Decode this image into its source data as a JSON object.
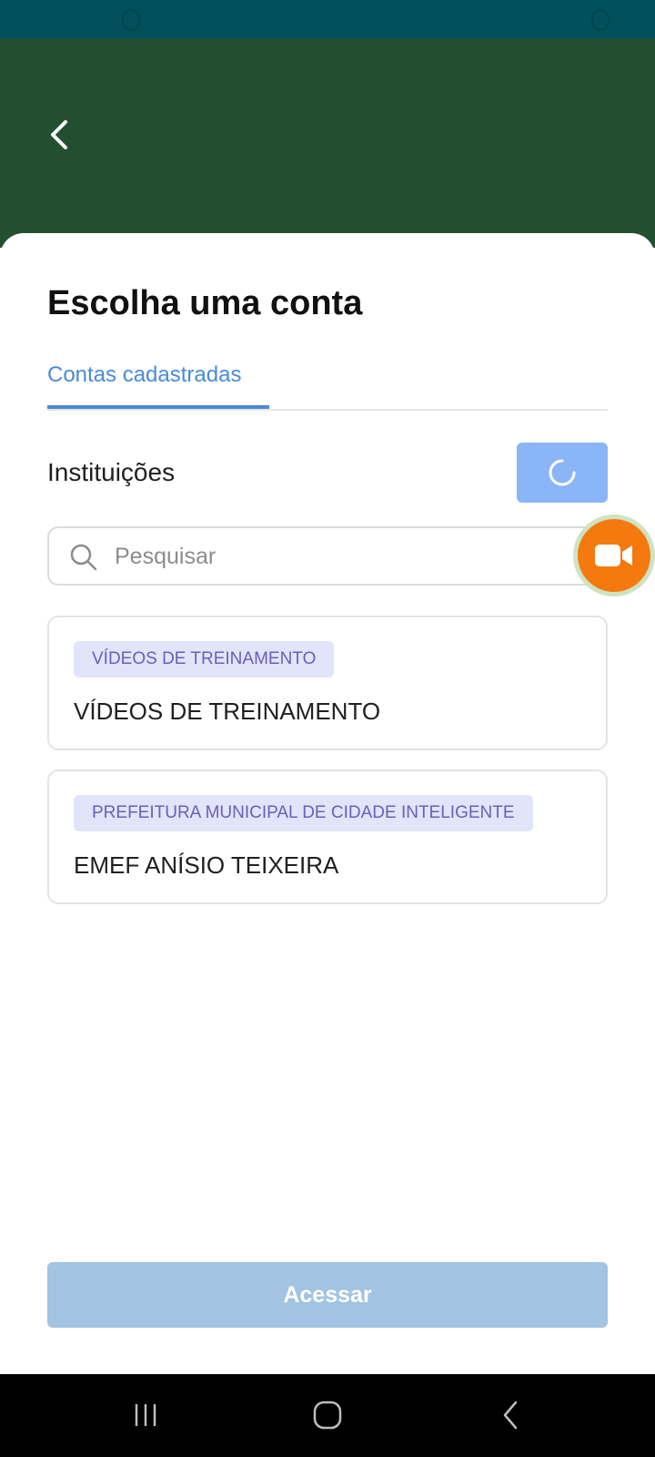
{
  "header": {
    "back_icon": "chevron-left-icon"
  },
  "page": {
    "title": "Escolha uma conta"
  },
  "tabs": [
    {
      "label": "Contas cadastradas",
      "active": true
    }
  ],
  "section": {
    "label": "Instituições",
    "refresh_icon": "refresh-icon"
  },
  "search": {
    "placeholder": "Pesquisar",
    "value": "",
    "icon": "search-icon"
  },
  "accounts": [
    {
      "badge": "VÍDEOS DE TREINAMENTO",
      "name": "VÍDEOS DE TREINAMENTO"
    },
    {
      "badge": "PREFEITURA MUNICIPAL DE CIDADE INTELIGENTE",
      "name": "EMEF ANÍSIO TEIXEIRA"
    }
  ],
  "floating": {
    "icon": "video-camera-icon"
  },
  "actions": {
    "access_label": "Acessar"
  },
  "system_nav": {
    "recents_icon": "recents-icon",
    "home_icon": "home-icon",
    "back_icon": "back-icon"
  },
  "colors": {
    "status_bar": "#01505c",
    "header": "#234f31",
    "accent": "#4a8ad6",
    "refresh_button": "#8ab5f6",
    "badge_bg": "#e2e4f9",
    "badge_text": "#6a5fb8",
    "fab": "#f47a10",
    "access_button": "#a2c3e2"
  }
}
